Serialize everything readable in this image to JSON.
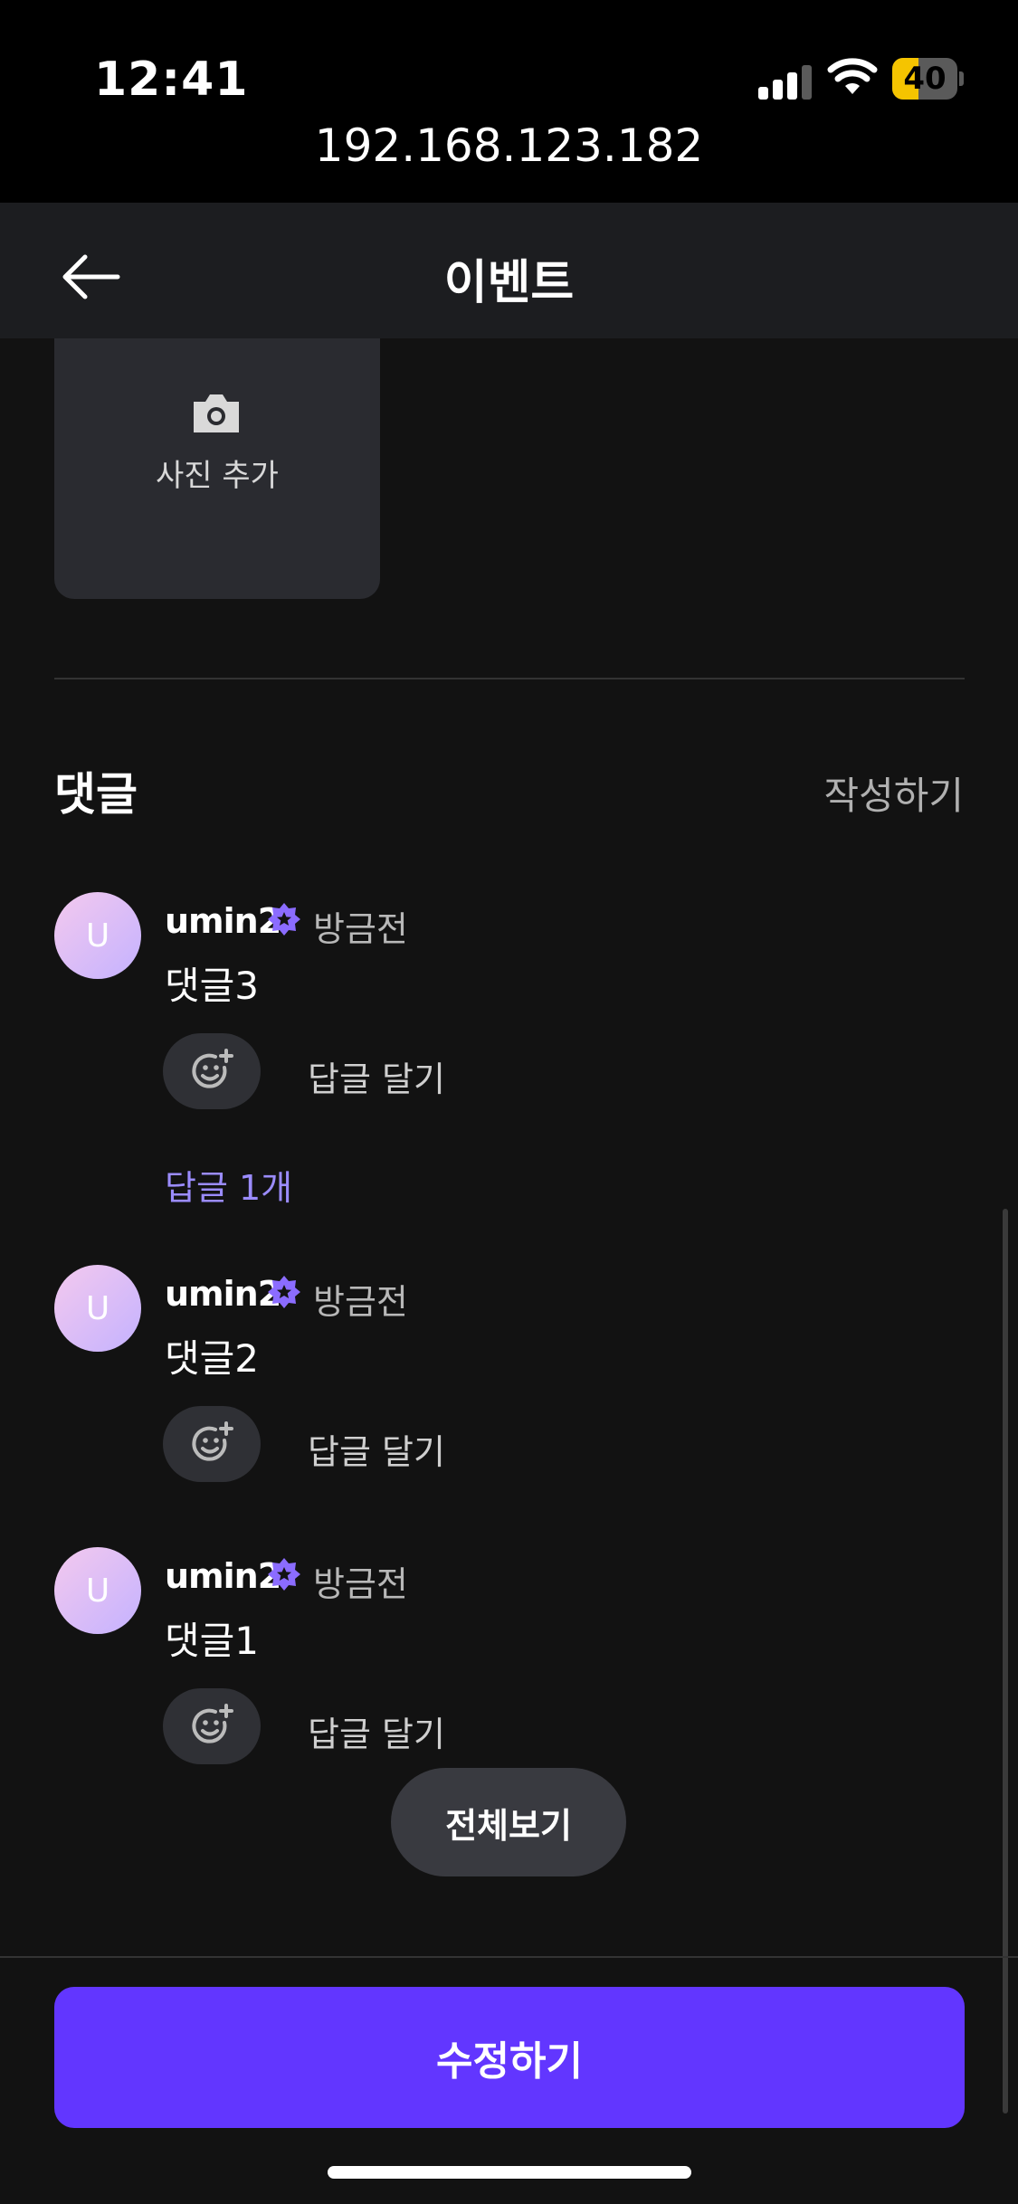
{
  "status_bar": {
    "time": "12:41",
    "battery": "40",
    "battery_level": 0.4
  },
  "browser": {
    "url": "192.168.123.182"
  },
  "header": {
    "title": "이벤트",
    "back_icon": "arrow-left-icon"
  },
  "photo": {
    "label": "사진 추가",
    "icon": "camera-icon"
  },
  "comments": {
    "title": "댓글",
    "write_label": "작성하기",
    "items": [
      {
        "avatar": "U",
        "username": "umin2",
        "time": "방금전",
        "text": "댓글3",
        "reply_label": "답글 달기",
        "replies_label": "답글 1개"
      },
      {
        "avatar": "U",
        "username": "umin2",
        "time": "방금전",
        "text": "댓글2",
        "reply_label": "답글 달기"
      },
      {
        "avatar": "U",
        "username": "umin2",
        "time": "방금전",
        "text": "댓글1",
        "reply_label": "답글 달기"
      }
    ],
    "view_all_label": "전체보기"
  },
  "footer": {
    "edit_label": "수정하기"
  },
  "colors": {
    "accent": "#6236ff",
    "link": "#9b8cff",
    "verified": "#8b6cff",
    "background": "#121212"
  }
}
